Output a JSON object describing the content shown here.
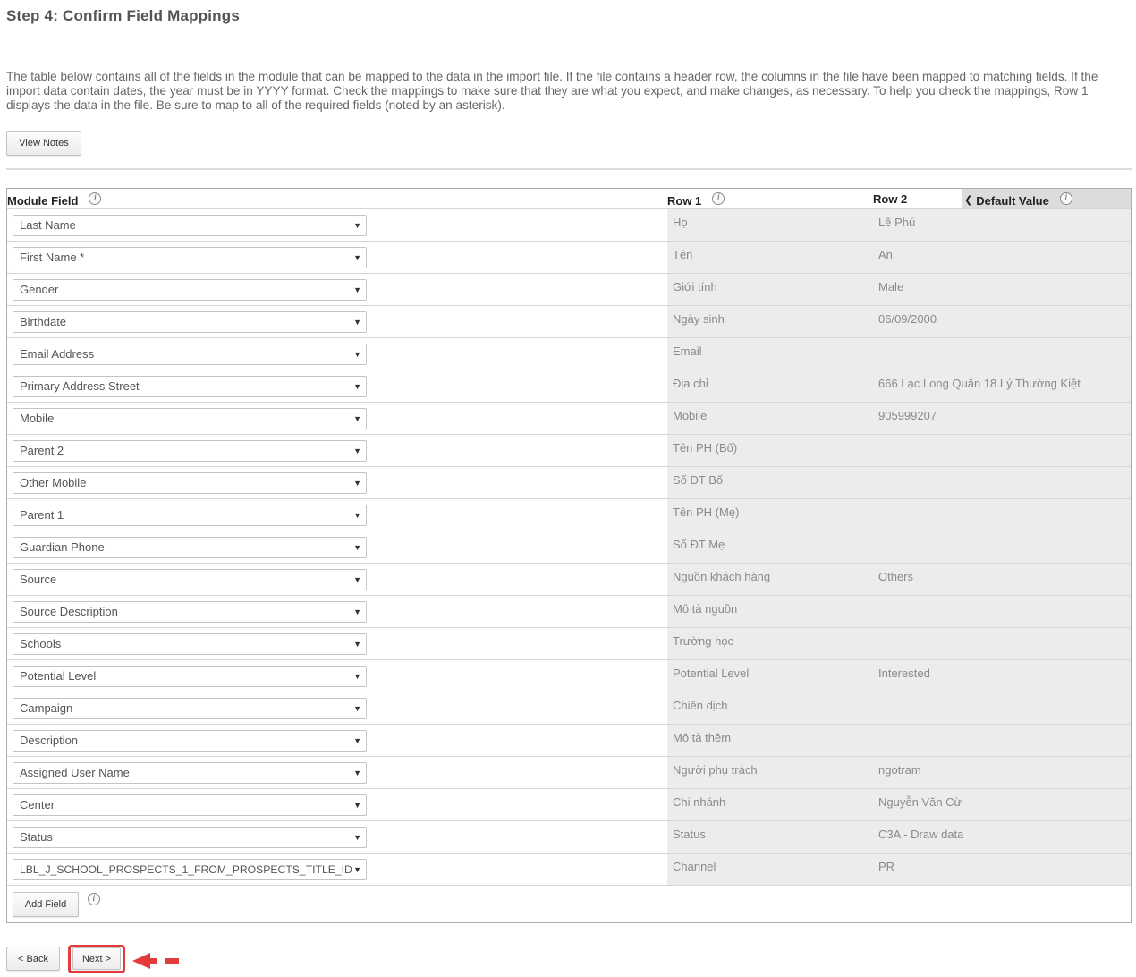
{
  "page": {
    "title": "Step 4: Confirm Field Mappings",
    "description": "The table below contains all of the fields in the module that can be mapped to the data in the import file. If the file contains a header row, the columns in the file have been mapped to matching fields. If the import data contain dates, the year must be in YYYY format. Check the mappings to make sure that they are what you expect, and make changes, as necessary. To help you check the mappings, Row 1 displays the data in the file. Be sure to map to all of the required fields (noted by an asterisk).",
    "view_notes_label": "View Notes"
  },
  "table": {
    "headers": {
      "module_field": "Module Field",
      "row1": "Row 1",
      "row2": "Row 2",
      "default_value": "Default Value"
    },
    "rows": [
      {
        "field": "Last Name",
        "row1": "Họ",
        "row2": "Lê Phú"
      },
      {
        "field": "First Name *",
        "row1": "Tên",
        "row2": "An"
      },
      {
        "field": "Gender",
        "row1": "Giới tính",
        "row2": "Male"
      },
      {
        "field": "Birthdate",
        "row1": "Ngày sinh",
        "row2": "06/09/2000"
      },
      {
        "field": "Email Address",
        "row1": "Email",
        "row2": ""
      },
      {
        "field": "Primary Address Street",
        "row1": "Địa chỉ",
        "row2": "666 Lạc Long Quân 18 Lý Thường Kiệt"
      },
      {
        "field": "Mobile",
        "row1": "Mobile",
        "row2": "905999207"
      },
      {
        "field": "Parent 2",
        "row1": "Tên PH (Bố)",
        "row2": ""
      },
      {
        "field": "Other Mobile",
        "row1": "Số ĐT Bố",
        "row2": ""
      },
      {
        "field": "Parent 1",
        "row1": "Tên PH (Mẹ)",
        "row2": ""
      },
      {
        "field": "Guardian Phone",
        "row1": "Số ĐT Mẹ",
        "row2": ""
      },
      {
        "field": "Source",
        "row1": "Nguồn khách hàng",
        "row2": "Others"
      },
      {
        "field": "Source Description",
        "row1": "Mô tả nguồn",
        "row2": ""
      },
      {
        "field": "Schools",
        "row1": "Trường học",
        "row2": ""
      },
      {
        "field": "Potential Level",
        "row1": "Potential Level",
        "row2": "Interested"
      },
      {
        "field": "Campaign",
        "row1": "Chiến dịch",
        "row2": ""
      },
      {
        "field": "Description",
        "row1": "Mô tả thêm",
        "row2": ""
      },
      {
        "field": "Assigned User Name",
        "row1": "Người phụ trách",
        "row2": "ngotram"
      },
      {
        "field": "Center",
        "row1": "Chi nhánh",
        "row2": "Nguyễn Văn Cừ"
      },
      {
        "field": "Status",
        "row1": "Status",
        "row2": "C3A - Draw data"
      },
      {
        "field": "LBL_J_SCHOOL_PROSPECTS_1_FROM_PROSPECTS_TITLE_ID",
        "row1": "Channel",
        "row2": "PR"
      }
    ],
    "add_field_label": "Add Field"
  },
  "footer": {
    "back_label": "< Back",
    "next_label": "Next >"
  },
  "icons": {
    "info": "info-icon",
    "collapse": "chevron-left-icon",
    "dropdown": "dropdown-arrow-icon",
    "annotation": "red-arrow-icon"
  },
  "colors": {
    "annotation": "#e23b3b"
  }
}
